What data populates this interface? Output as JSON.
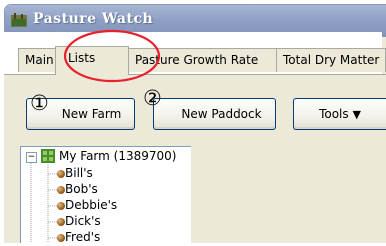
{
  "window": {
    "title": "Pasture Watch",
    "app_icon": "pasture-app-icon"
  },
  "tabs": [
    "Main",
    "Lists",
    "Pasture Growth Rate",
    "Total Dry Matter"
  ],
  "toolbar": {
    "new_farm_label": "New Farm",
    "new_paddock_label": "New Paddock",
    "tools_label": "Tools",
    "step1": "①",
    "step2": "②"
  },
  "tree": {
    "root": "My Farm (1389700)",
    "items": [
      "Bill's",
      "Bob's",
      "Debbie's",
      "Dick's",
      "Fred's"
    ]
  },
  "colors": {
    "annotation_circle": "#e8202a",
    "titlebar": "#90a1c4"
  }
}
